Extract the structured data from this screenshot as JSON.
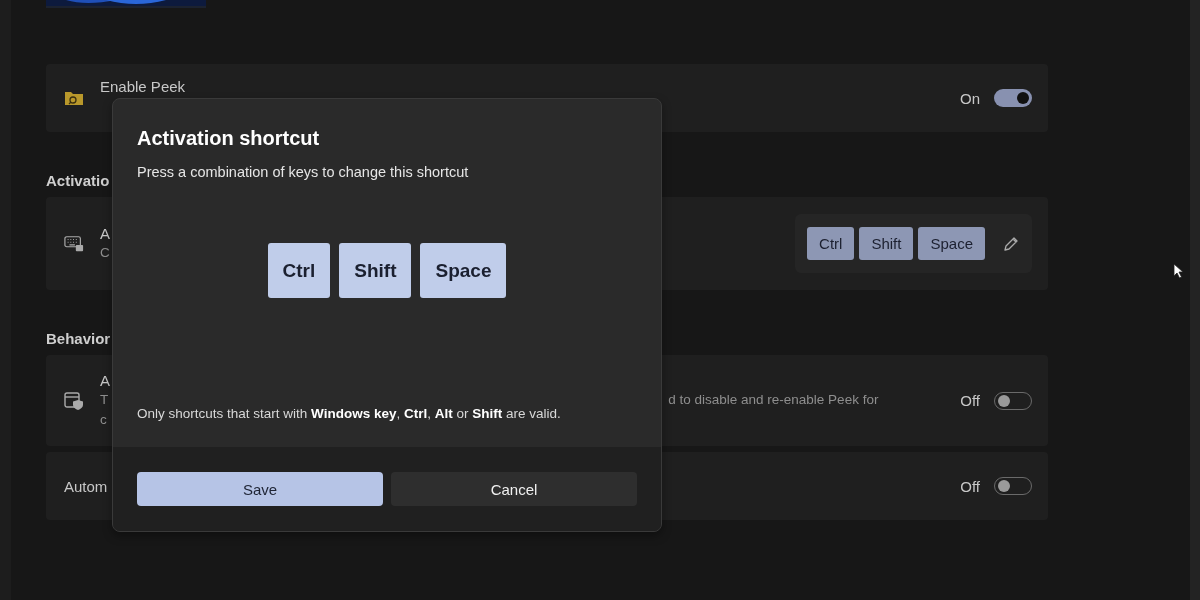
{
  "cards": [
    {
      "kind": "toggle",
      "title": "Enable Peek",
      "state_text": "On",
      "on": true
    },
    {
      "kind": "shortcut",
      "header": "Activatio",
      "title": "A",
      "description": [
        "C"
      ],
      "keys": [
        "Ctrl",
        "Shift",
        "Space"
      ]
    },
    {
      "kind": "toggle",
      "header": "Behavior",
      "title": "A",
      "description": [
        "T",
        "c"
      ],
      "description_tail": "d to disable and re-enable Peek for",
      "state_text": "Off",
      "on": false
    },
    {
      "kind": "toggle",
      "title": "Autom",
      "state_text": "Off",
      "on": false
    }
  ],
  "dialog": {
    "title": "Activation shortcut",
    "subtitle": "Press a combination of keys to change this shortcut",
    "keys": [
      "Ctrl",
      "Shift",
      "Space"
    ],
    "note": "Only shortcuts that start with **Windows key**, **Ctrl**, **Alt** or **Shift** are valid.",
    "buttons": [
      {
        "label": "Save",
        "primary": true
      },
      {
        "label": "Cancel",
        "primary": false
      }
    ]
  }
}
